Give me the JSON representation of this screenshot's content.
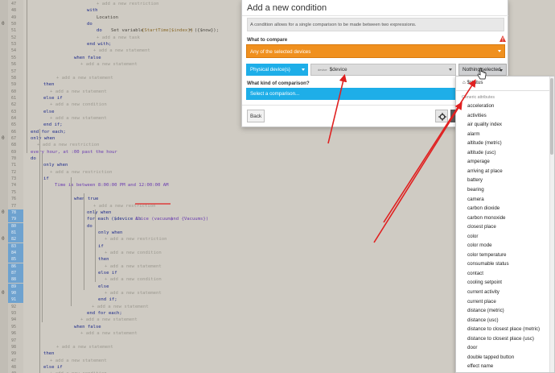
{
  "editor": {
    "line_numbers": [
      "47",
      "48",
      "49",
      "50",
      "51",
      "52",
      "53",
      "54",
      "55",
      "56",
      "57",
      "58",
      "59",
      "60",
      "61",
      "62",
      "63",
      "64",
      "65",
      "66",
      "67",
      "68",
      "69",
      "70",
      "71",
      "72",
      "73",
      "74",
      "75",
      "76",
      "77",
      "78",
      "79",
      "80",
      "81",
      "82",
      "83",
      "84",
      "85",
      "86",
      "87",
      "88",
      "89",
      "90",
      "91",
      "92",
      "93",
      "94",
      "95",
      "96",
      "97",
      "98",
      "99"
    ],
    "fragments": {
      "add_restriction": "+ add a new restriction",
      "add_restriction_short": "+ add a new restriction",
      "with": "with",
      "location": "Location",
      "do": "do",
      "do_set_keyword": "do",
      "set_variable": "Set variable",
      "set_var_name": "{StartTime[$index]}",
      "set_var_value": "= ({$now});",
      "add_task": "+ add a new task",
      "end_with": "end with;",
      "add_statement": "+ add a new statement",
      "when_false": "when false",
      "then": "then",
      "add_condition": "+ add a new condition",
      "else_if": "else if",
      "else": "else",
      "end_if": "end if;",
      "end_for_each": "end for each;",
      "only_when": "only when",
      "every_hour": "every hour, at :00 past the hour",
      "if": "if",
      "time_between": "Time is between 8:00:00 PM and 12:00:00 AM",
      "when_true": "when true",
      "for_each": "for each ($device in",
      "alice_vacuum": "Alice (vacuum)",
      "and_vacuums": "and {Vacuums})",
      "end_every": "end every;"
    }
  },
  "dialog": {
    "title": "Add a new condition",
    "info": "A condition allows for a single comparison to be made between two expressions.",
    "compare_label": "What to compare",
    "compare_value": "Any of the selected devices",
    "physical_label": "Physical device(s)",
    "device_prefix": "device",
    "device_value": "$device",
    "attribute_value": "Nothing selected",
    "kind_label": "What kind of comparison?",
    "kind_value": "Select a comparison...",
    "back_label": "Back"
  },
  "attributes": {
    "status_item": "$status",
    "group_label": "Generic attributes",
    "items": [
      "acceleration",
      "activities",
      "air quality index",
      "alarm",
      "altitude (metric)",
      "altitude (usc)",
      "amperage",
      "arriving at place",
      "battery",
      "bearing",
      "camera",
      "carbon dioxide",
      "carbon monoxide",
      "closest place",
      "color",
      "color mode",
      "color temperature",
      "consumable status",
      "contact",
      "cooling setpoint",
      "current activity",
      "current place",
      "distance (metric)",
      "distance (usc)",
      "distance to closest place (metric)",
      "distance to closest place (usc)",
      "door",
      "double tapped button",
      "effect name"
    ]
  },
  "colors": {
    "accent_orange": "#f0901e",
    "accent_blue": "#1eaee8",
    "annotation_red": "#e02020"
  }
}
